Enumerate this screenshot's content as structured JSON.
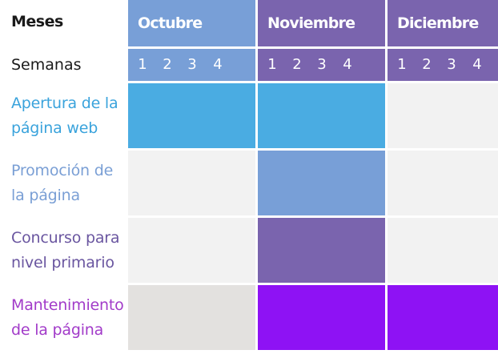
{
  "header": {
    "months_label": "Meses",
    "weeks_label": "Semanas"
  },
  "chart_data": {
    "type": "table",
    "months": [
      {
        "name": "Octubre",
        "color": "#789fd7"
      },
      {
        "name": "Noviembre",
        "color": "#7a64ae"
      },
      {
        "name": "Diciembre",
        "color": "#7a64ae"
      }
    ],
    "weeks": [
      "1",
      "2",
      "3",
      "4"
    ],
    "tasks": [
      {
        "label": "Apertura de la página web",
        "label_color": "#3aa3dc",
        "row_bg": "#f2f2f2",
        "fills": [
          "#4aace2",
          "#4aace2",
          null
        ]
      },
      {
        "label": "Promoción de la página",
        "label_color": "#7a9fd5",
        "row_bg": "#f2f2f2",
        "fills": [
          null,
          "#789fd7",
          null
        ]
      },
      {
        "label": "Concurso para nivel primario",
        "label_color": "#6a56a0",
        "row_bg": "#f2f2f2",
        "fills": [
          null,
          "#7a64ae",
          null
        ]
      },
      {
        "label": "Mantenimiento de la página",
        "label_color": "#a23bc9",
        "row_bg": "#e3e1df",
        "fills": [
          "#e3e1df",
          "#8e12f4",
          "#8e12f4"
        ]
      }
    ]
  }
}
